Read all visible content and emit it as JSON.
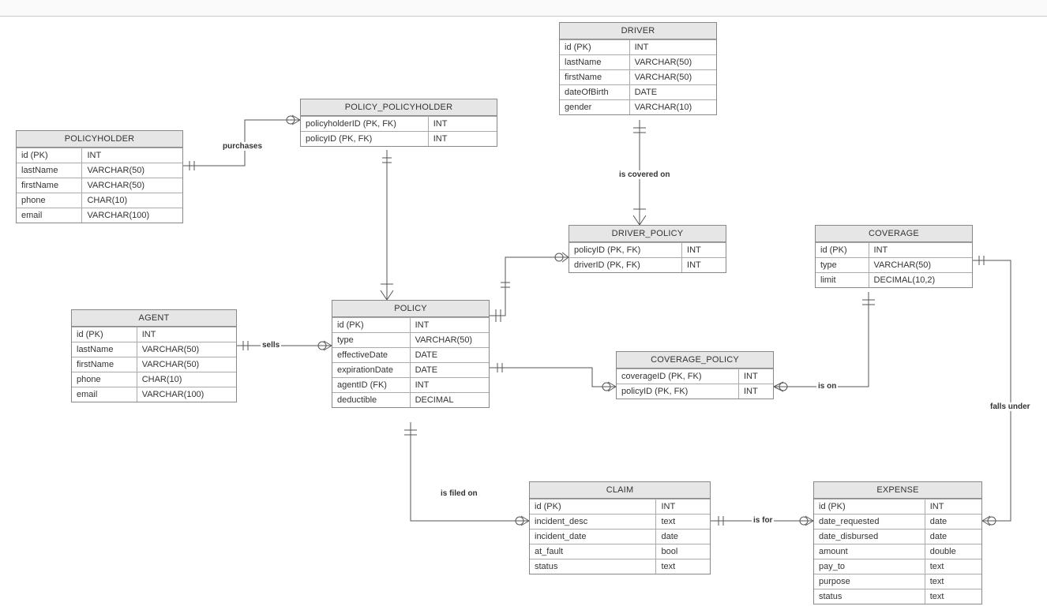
{
  "entities": {
    "policyholder": {
      "title": "POLICYHOLDER",
      "rows": [
        {
          "name": "id (PK)",
          "type": "INT"
        },
        {
          "name": "lastName",
          "type": "VARCHAR(50)"
        },
        {
          "name": "firstName",
          "type": "VARCHAR(50)"
        },
        {
          "name": "phone",
          "type": "CHAR(10)"
        },
        {
          "name": "email",
          "type": "VARCHAR(100)"
        }
      ]
    },
    "policy_policyholder": {
      "title": "POLICY_POLICYHOLDER",
      "rows": [
        {
          "name": "policyholderID (PK, FK)",
          "type": "INT"
        },
        {
          "name": "policyID (PK, FK)",
          "type": "INT"
        }
      ]
    },
    "driver": {
      "title": "DRIVER",
      "rows": [
        {
          "name": "id (PK)",
          "type": "INT"
        },
        {
          "name": "lastName",
          "type": "VARCHAR(50)"
        },
        {
          "name": "firstName",
          "type": "VARCHAR(50)"
        },
        {
          "name": "dateOfBirth",
          "type": "DATE"
        },
        {
          "name": "gender",
          "type": "VARCHAR(10)"
        }
      ]
    },
    "agent": {
      "title": "AGENT",
      "rows": [
        {
          "name": "id (PK)",
          "type": "INT"
        },
        {
          "name": "lastName",
          "type": "VARCHAR(50)"
        },
        {
          "name": "firstName",
          "type": "VARCHAR(50)"
        },
        {
          "name": "phone",
          "type": "CHAR(10)"
        },
        {
          "name": "email",
          "type": "VARCHAR(100)"
        }
      ]
    },
    "policy": {
      "title": "POLICY",
      "rows": [
        {
          "name": "id (PK)",
          "type": "INT"
        },
        {
          "name": "type",
          "type": "VARCHAR(50)"
        },
        {
          "name": "effectiveDate",
          "type": "DATE"
        },
        {
          "name": "expirationDate",
          "type": "DATE"
        },
        {
          "name": "agentID (FK)",
          "type": "INT"
        },
        {
          "name": "deductible",
          "type": "DECIMAL"
        }
      ]
    },
    "driver_policy": {
      "title": "DRIVER_POLICY",
      "rows": [
        {
          "name": "policyID (PK, FK)",
          "type": "INT"
        },
        {
          "name": "driverID (PK, FK)",
          "type": "INT"
        }
      ]
    },
    "coverage": {
      "title": "COVERAGE",
      "rows": [
        {
          "name": "id (PK)",
          "type": "INT"
        },
        {
          "name": "type",
          "type": "VARCHAR(50)"
        },
        {
          "name": "limit",
          "type": "DECIMAL(10,2)"
        }
      ]
    },
    "coverage_policy": {
      "title": "COVERAGE_POLICY",
      "rows": [
        {
          "name": "coverageID (PK, FK)",
          "type": "INT"
        },
        {
          "name": "policyID (PK, FK)",
          "type": "INT"
        }
      ]
    },
    "claim": {
      "title": "CLAIM",
      "rows": [
        {
          "name": "id (PK)",
          "type": "INT"
        },
        {
          "name": "incident_desc",
          "type": "text"
        },
        {
          "name": "incident_date",
          "type": "date"
        },
        {
          "name": "at_fault",
          "type": "bool"
        },
        {
          "name": "status",
          "type": "text"
        }
      ]
    },
    "expense": {
      "title": "EXPENSE",
      "rows": [
        {
          "name": "id (PK)",
          "type": "INT"
        },
        {
          "name": "date_requested",
          "type": "date"
        },
        {
          "name": "date_disbursed",
          "type": "date"
        },
        {
          "name": "amount",
          "type": "double"
        },
        {
          "name": "pay_to",
          "type": "text"
        },
        {
          "name": "purpose",
          "type": "text"
        },
        {
          "name": "status",
          "type": "text"
        }
      ]
    }
  },
  "relationships": {
    "purchases": "purchases",
    "is_covered_on": "is covered on",
    "sells": "sells",
    "is_on": "is on",
    "is_filed_on": "is filed on",
    "is_for": "is for",
    "falls_under": "falls under"
  }
}
